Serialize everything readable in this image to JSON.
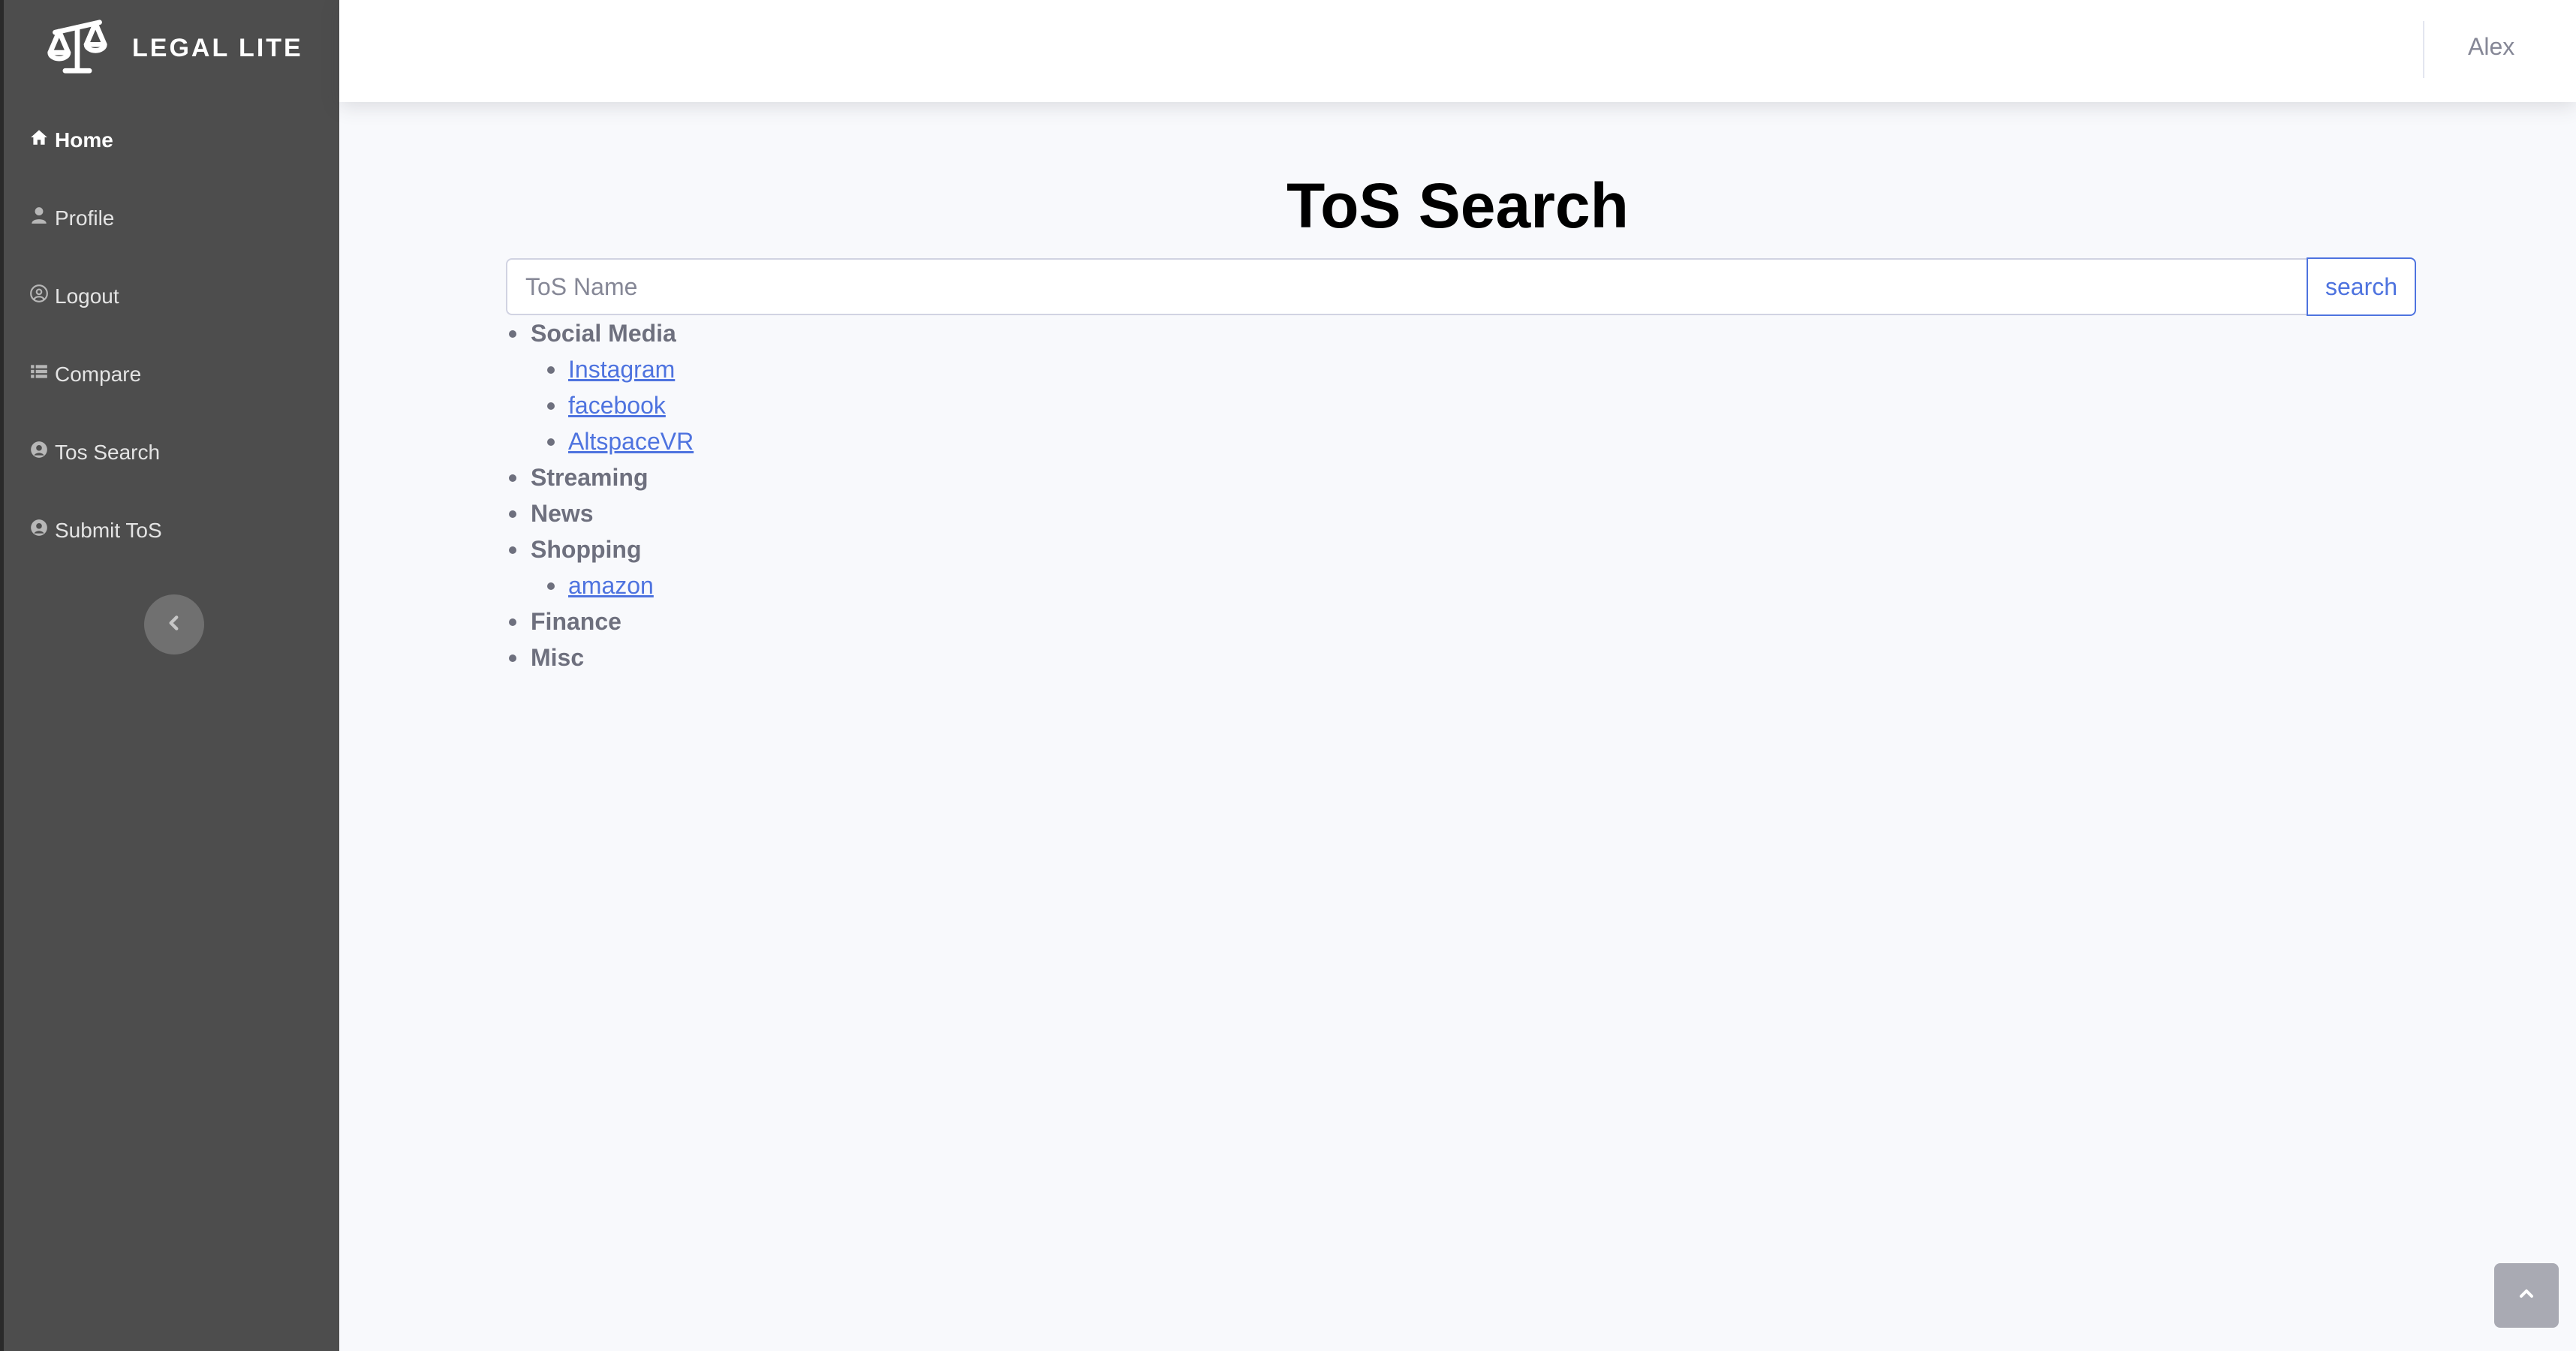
{
  "brand": {
    "name": "LEGAL LITE",
    "logo_icon": "scales-icon"
  },
  "sidebar": {
    "items": [
      {
        "label": "Home",
        "icon": "home-icon",
        "active": true
      },
      {
        "label": "Profile",
        "icon": "user-icon",
        "active": false
      },
      {
        "label": "Logout",
        "icon": "user-circle-icon",
        "active": false
      },
      {
        "label": "Compare",
        "icon": "list-icon",
        "active": false
      },
      {
        "label": "Tos Search",
        "icon": "user-circle-icon",
        "active": false
      },
      {
        "label": "Submit ToS",
        "icon": "user-circle-icon",
        "active": false
      }
    ],
    "collapse_icon": "chevron-left-icon"
  },
  "topbar": {
    "user_name": "Alex"
  },
  "main": {
    "title": "ToS Search",
    "search": {
      "placeholder": "ToS Name",
      "value": "",
      "button_label": "search"
    },
    "categories": [
      {
        "name": "Social Media",
        "items": [
          "Instagram",
          "facebook",
          "AltspaceVR"
        ]
      },
      {
        "name": "Streaming",
        "items": []
      },
      {
        "name": "News",
        "items": []
      },
      {
        "name": "Shopping",
        "items": [
          "amazon"
        ]
      },
      {
        "name": "Finance",
        "items": []
      },
      {
        "name": "Misc",
        "items": []
      }
    ]
  },
  "colors": {
    "sidebar_bg": "#4d4d4d",
    "accent": "#4e73df",
    "page_bg": "#f8f9fc"
  },
  "scroll_top_icon": "chevron-up-icon"
}
